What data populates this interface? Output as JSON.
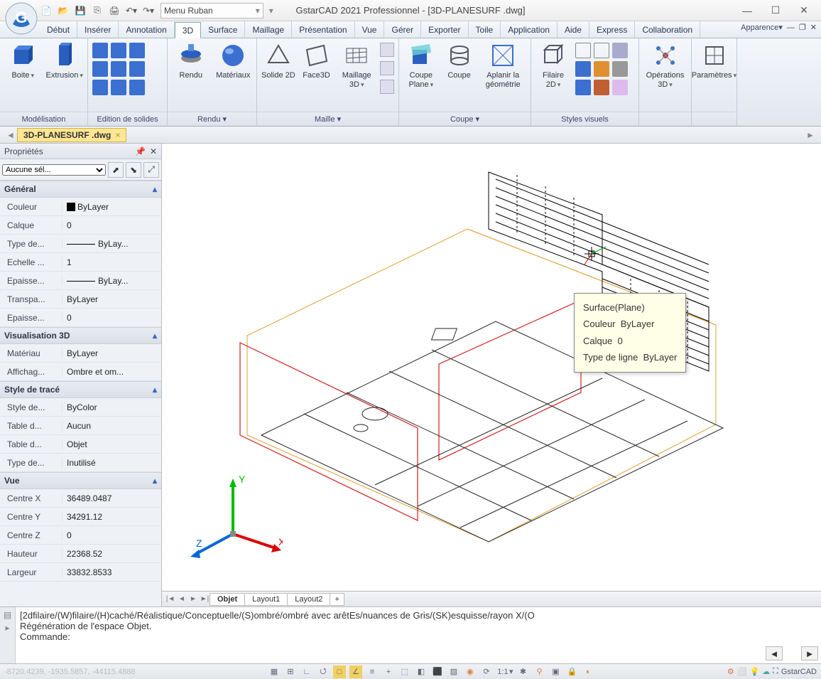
{
  "title": "GstarCAD 2021 Professionnel - [3D-PLANESURF .dwg]",
  "menuruban": "Menu Ruban",
  "menutabs": [
    "Début",
    "Insérer",
    "Annotation",
    "3D",
    "Surface",
    "Maillage",
    "Présentation",
    "Vue",
    "Gérer",
    "Exporter",
    "Toile",
    "Application",
    "Aide",
    "Express",
    "Collaboration"
  ],
  "menutab_active": 3,
  "appearance": "Apparence",
  "ribbon": {
    "groups": [
      {
        "label": "Modélisation",
        "big": [
          {
            "t": "Boite"
          },
          {
            "t": "Extrusion"
          }
        ]
      },
      {
        "label": "Edition de solides"
      },
      {
        "label": "Rendu",
        "big": [
          {
            "t": "Rendu"
          },
          {
            "t": "Matériaux"
          }
        ]
      },
      {
        "label": "Maille",
        "big": [
          {
            "t": "Solide 2D"
          },
          {
            "t": "Face3D"
          },
          {
            "t": "Maillage 3D"
          }
        ]
      },
      {
        "label": "Coupe",
        "big": [
          {
            "t": "Coupe Plane"
          },
          {
            "t": "Coupe"
          },
          {
            "t": "Aplanir la géométrie"
          }
        ]
      },
      {
        "label": "Styles visuels",
        "big": [
          {
            "t": "Filaire 2D"
          }
        ]
      },
      {
        "label": "",
        "big": [
          {
            "t": "Opérations 3D"
          }
        ]
      },
      {
        "label": "",
        "big": [
          {
            "t": "Paramètres"
          }
        ]
      }
    ]
  },
  "doctab": "3D-PLANESURF .dwg",
  "properties": {
    "title": "Propriétés",
    "selection": "Aucune sél...",
    "groups": [
      {
        "name": "Général",
        "rows": [
          {
            "k": "Couleur",
            "v": "ByLayer",
            "color": true
          },
          {
            "k": "Calque",
            "v": "0"
          },
          {
            "k": "Type de...",
            "v": "ByLay...",
            "line": true
          },
          {
            "k": "Echelle ...",
            "v": "1"
          },
          {
            "k": "Epaisse...",
            "v": "ByLay...",
            "line": true
          },
          {
            "k": "Transpa...",
            "v": "ByLayer"
          },
          {
            "k": "Epaisse...",
            "v": "0"
          }
        ]
      },
      {
        "name": "Visualisation 3D",
        "rows": [
          {
            "k": "Matériau",
            "v": "ByLayer"
          },
          {
            "k": "Affichag...",
            "v": "Ombre et om..."
          }
        ]
      },
      {
        "name": "Style de tracé",
        "rows": [
          {
            "k": "Style de...",
            "v": "ByColor"
          },
          {
            "k": "Table d...",
            "v": "Aucun"
          },
          {
            "k": "Table d...",
            "v": "Objet"
          },
          {
            "k": "Type de...",
            "v": "Inutilisé"
          }
        ]
      },
      {
        "name": "Vue",
        "rows": [
          {
            "k": "Centre X",
            "v": "36489.0487"
          },
          {
            "k": "Centre Y",
            "v": "34291.12"
          },
          {
            "k": "Centre Z",
            "v": "0"
          },
          {
            "k": "Hauteur",
            "v": "22368.52"
          },
          {
            "k": "Largeur",
            "v": "33832.8533"
          }
        ]
      }
    ]
  },
  "layouts": [
    "Objet",
    "Layout1",
    "Layout2"
  ],
  "cmd": {
    "l1": "[2dfilaire/(W)filaire/(H)caché/Réalistique/Conceptuelle/(S)ombré/ombré avec arêtEs/nuances de Gris/(SK)esquisse/rayon X/(O",
    "l2": "Régénération de l'espace Objet.",
    "l3": "Commande:"
  },
  "status": {
    "coords": "-8720.4239, -1935.5857, -44115.4888",
    "scale": "1:1",
    "brand": "GstarCAD"
  },
  "tooltip": {
    "r1": "Surface(Plane)",
    "r2k": "Couleur",
    "r2v": "ByLayer",
    "r3k": "Calque",
    "r3v": "0",
    "r4k": "Type de ligne",
    "r4v": "ByLayer"
  },
  "axis": {
    "x": "X",
    "y": "Y",
    "z": "Z"
  }
}
